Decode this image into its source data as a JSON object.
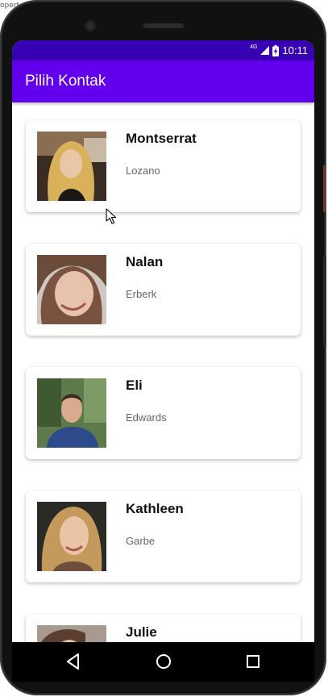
{
  "corner_text": "opert",
  "status_bar": {
    "network_label": "4G",
    "time": "10:11",
    "background_color": "#3700b3"
  },
  "app_bar": {
    "title": "Pilih Kontak",
    "background_color": "#6200ee"
  },
  "contacts": [
    {
      "first_name": "Montserrat",
      "last_name": "Lozano",
      "avatar": "photo-blonde-woman"
    },
    {
      "first_name": "Nalan",
      "last_name": "Erberk",
      "avatar": "photo-brunette-woman"
    },
    {
      "first_name": "Eli",
      "last_name": "Edwards",
      "avatar": "photo-man-outdoors"
    },
    {
      "first_name": "Kathleen",
      "last_name": "Garbe",
      "avatar": "photo-smiling-woman"
    },
    {
      "first_name": "Julie",
      "last_name": "",
      "avatar": "photo-woman"
    }
  ],
  "nav_bar": {
    "icons": [
      "back-icon",
      "home-icon",
      "recents-icon"
    ]
  }
}
